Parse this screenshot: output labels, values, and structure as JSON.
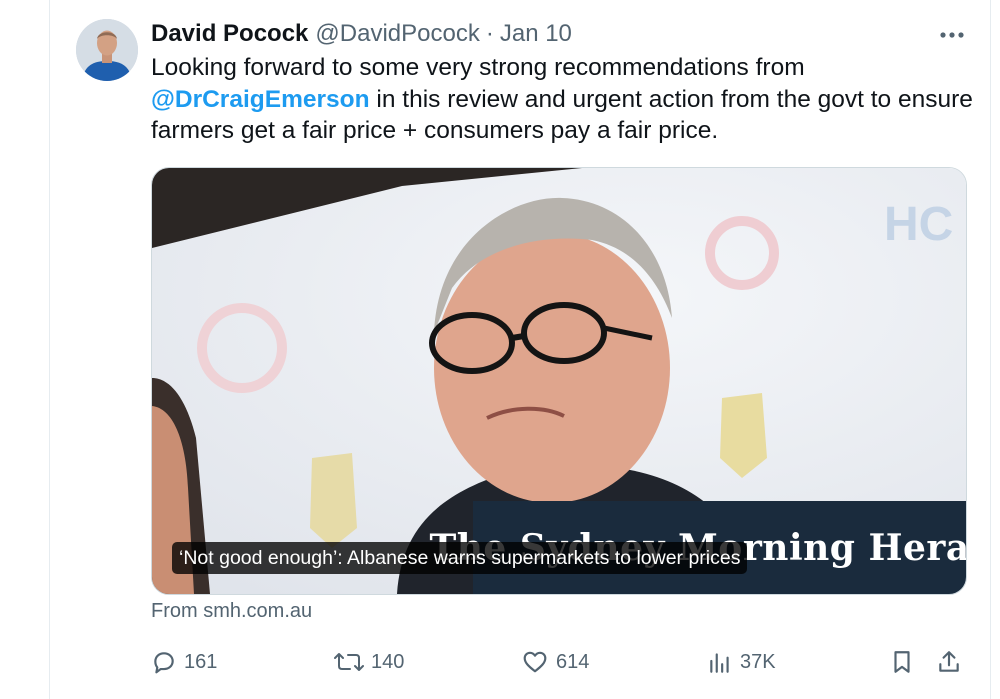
{
  "author": {
    "name": "David Pocock",
    "handle": "@DavidPocock",
    "separator": "·",
    "date": "Jan 10"
  },
  "tweet": {
    "text_before": "Looking forward to some very strong recommendations from ",
    "mention": "@DrCraigEmerson",
    "text_after": " in this review and urgent action from the govt to ensure farmers get a fair price + consumers pay a fair price."
  },
  "card": {
    "headline": "‘Not good enough’: Albanese warns supermarkets to lower prices",
    "masthead": "The Sydney Morning Herald",
    "source": "From smh.com.au"
  },
  "metrics": {
    "replies": "161",
    "reposts": "140",
    "likes": "614",
    "views": "37K"
  },
  "colors": {
    "accent": "#1d9bf0",
    "text": "#0f1419",
    "secondary": "#536471",
    "border": "#cfd9de"
  },
  "icons": [
    "more-icon",
    "reply-icon",
    "repost-icon",
    "like-icon",
    "views-icon",
    "bookmark-icon",
    "share-icon"
  ]
}
